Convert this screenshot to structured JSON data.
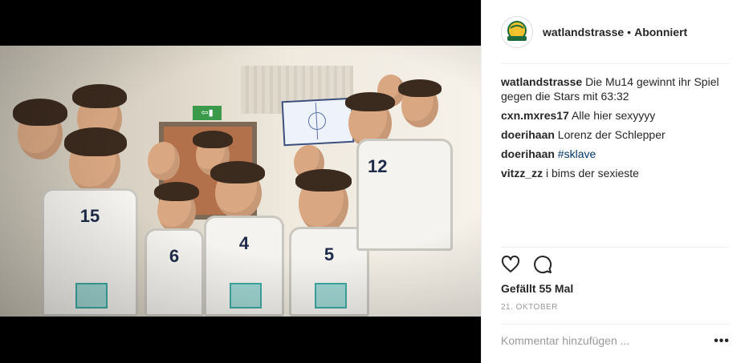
{
  "post": {
    "username": "watlandstrasse",
    "separator": "•",
    "follow_status": "Abonniert",
    "avatar_icon": "team-logo-icon",
    "comments": [
      {
        "user": "watlandstrasse",
        "text": "Die Mu14 gewinnt ihr Spiel gegen die Stars mit 63:32"
      },
      {
        "user": "cxn.mxres17",
        "text": "Alle hier sexyyyy"
      },
      {
        "user": "doerihaan",
        "text": "Lorenz der Schlepper"
      },
      {
        "user": "doerihaan",
        "text": "#sklave"
      },
      {
        "user": "vitzz_zz",
        "text": "i bims der sexieste"
      }
    ],
    "likes": "Gefällt 55 Mal",
    "date": "21. OKTOBER",
    "comment_placeholder": "Kommentar hinzufügen ...",
    "more_label": "•••",
    "icons": {
      "like": "heart-icon",
      "comment": "comment-bubble-icon"
    }
  },
  "photo": {
    "exit_sign": "⇦▮",
    "jersey_numbers": [
      "15",
      "6",
      "4",
      "5",
      "12"
    ]
  },
  "colors": {
    "link": "#003569",
    "muted": "#999999",
    "divider": "#efefef"
  }
}
